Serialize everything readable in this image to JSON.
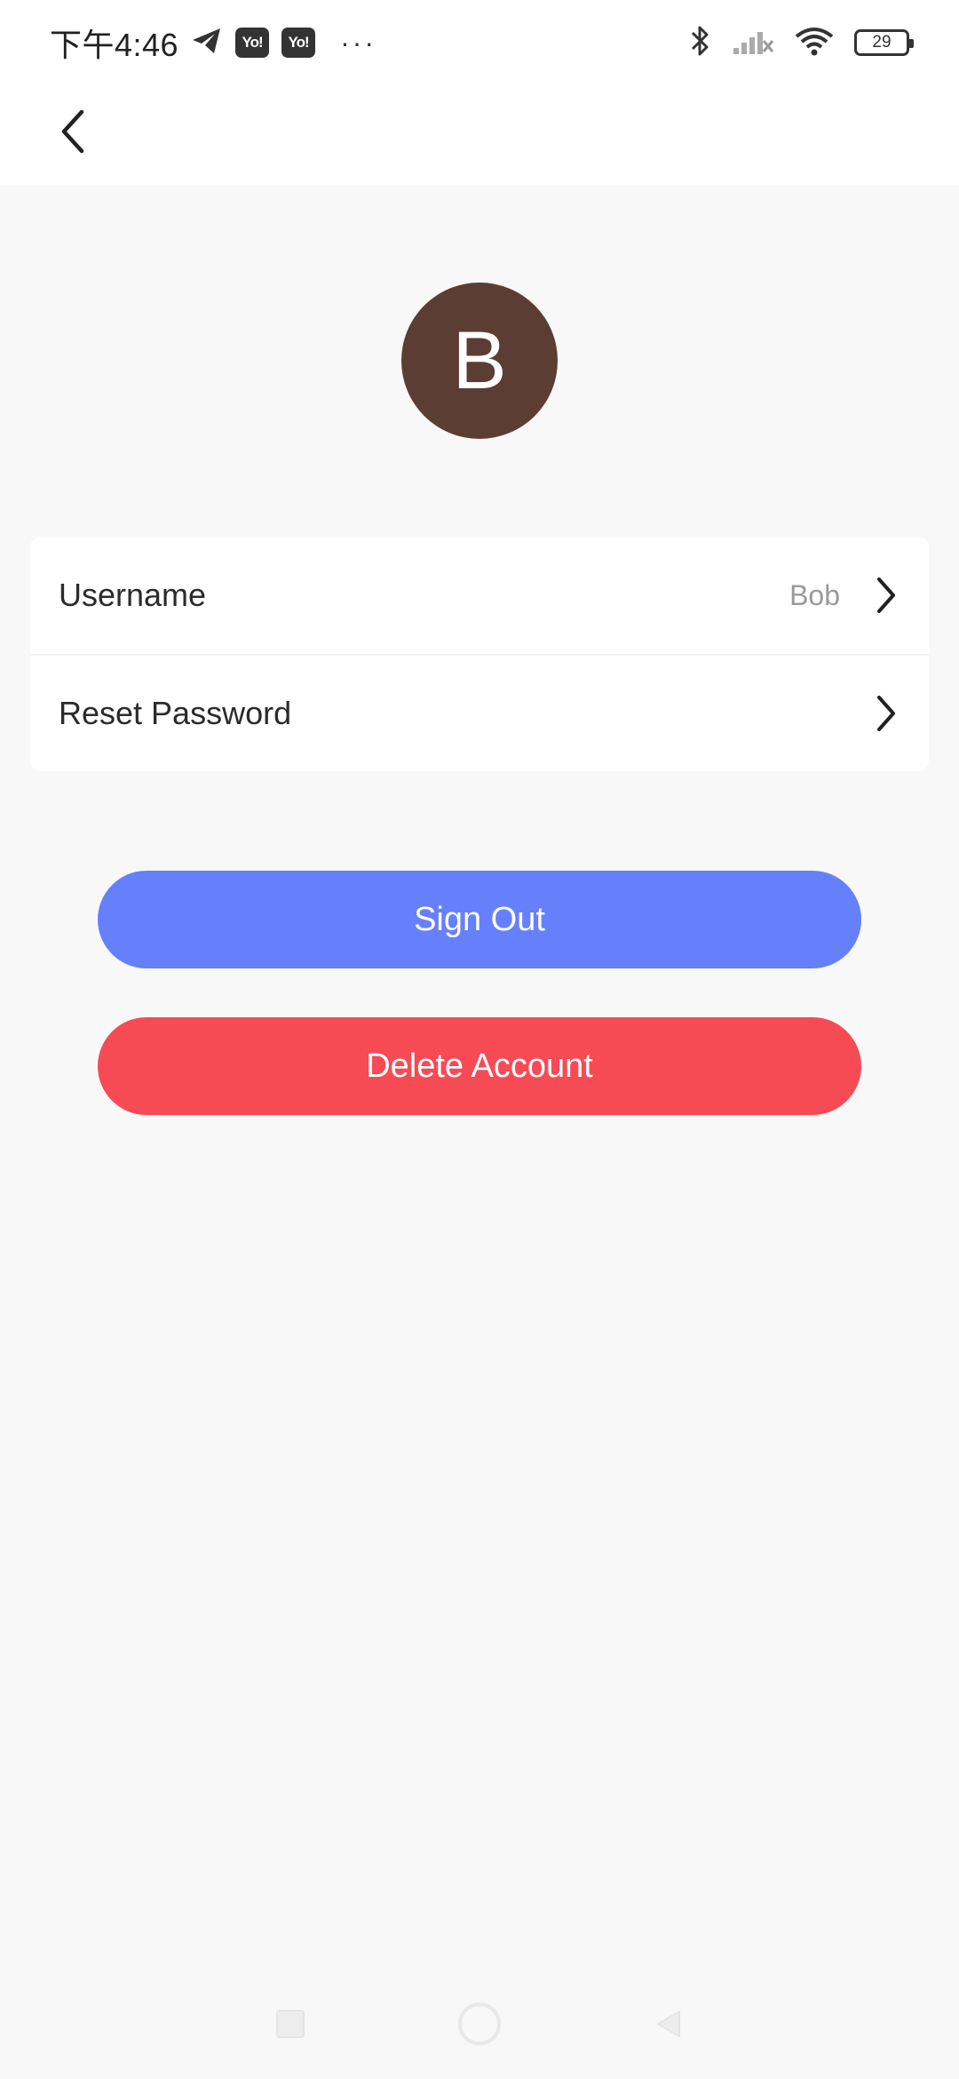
{
  "status_bar": {
    "time": "下午4:46",
    "app_badge_1": "Yo!",
    "app_badge_2": "Yo!",
    "more": "···",
    "battery": "29",
    "icons": [
      "telegram-icon",
      "bluetooth-icon",
      "signal-icon",
      "wifi-icon",
      "battery-icon"
    ]
  },
  "header": {
    "back_icon": "chevron-left-icon"
  },
  "profile": {
    "avatar_initial": "B",
    "avatar_color": "#5c3d33"
  },
  "settings": {
    "username_label": "Username",
    "username_value": "Bob",
    "reset_password_label": "Reset Password"
  },
  "actions": {
    "sign_out_label": "Sign Out",
    "sign_out_color": "#6680fc",
    "delete_account_label": "Delete Account",
    "delete_account_color": "#f64b55"
  },
  "nav": {
    "icons": [
      "recents-square-icon",
      "home-circle-icon",
      "back-triangle-icon"
    ]
  }
}
